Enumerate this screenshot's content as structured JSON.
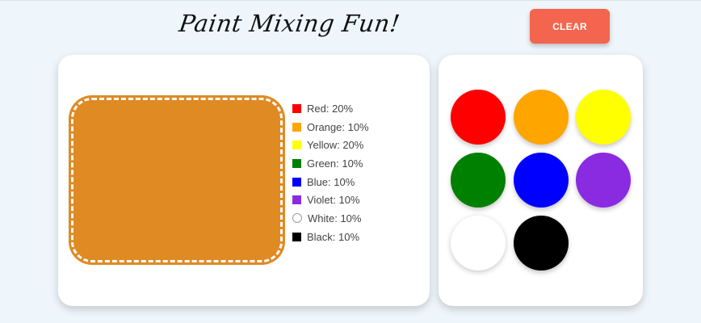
{
  "header": {
    "title": "Paint Mixing Fun!",
    "clear_label": "CLEAR",
    "clear_color": "#f3654e"
  },
  "mixture": {
    "color": "#df8a23"
  },
  "legend": [
    {
      "name": "Red",
      "percent": "20%",
      "label": "Red: 20%",
      "color": "#ff0000"
    },
    {
      "name": "Orange",
      "percent": "10%",
      "label": "Orange: 10%",
      "color": "#ffa500"
    },
    {
      "name": "Yellow",
      "percent": "20%",
      "label": "Yellow: 20%",
      "color": "#ffff00"
    },
    {
      "name": "Green",
      "percent": "10%",
      "label": "Green: 10%",
      "color": "#008000"
    },
    {
      "name": "Blue",
      "percent": "10%",
      "label": "Blue: 10%",
      "color": "#0000ff"
    },
    {
      "name": "Violet",
      "percent": "10%",
      "label": "Violet: 10%",
      "color": "#8a2be2"
    },
    {
      "name": "White",
      "percent": "10%",
      "label": "White: 10%",
      "color": "#ffffff"
    },
    {
      "name": "Black",
      "percent": "10%",
      "label": "Black: 10%",
      "color": "#000000"
    }
  ],
  "palette": [
    {
      "name": "red",
      "color": "#ff0000"
    },
    {
      "name": "orange",
      "color": "#ffa500"
    },
    {
      "name": "yellow",
      "color": "#ffff00"
    },
    {
      "name": "green",
      "color": "#008000"
    },
    {
      "name": "blue",
      "color": "#0000ff"
    },
    {
      "name": "violet",
      "color": "#8a2be2"
    },
    {
      "name": "white",
      "color": "#ffffff"
    },
    {
      "name": "black",
      "color": "#000000"
    }
  ]
}
